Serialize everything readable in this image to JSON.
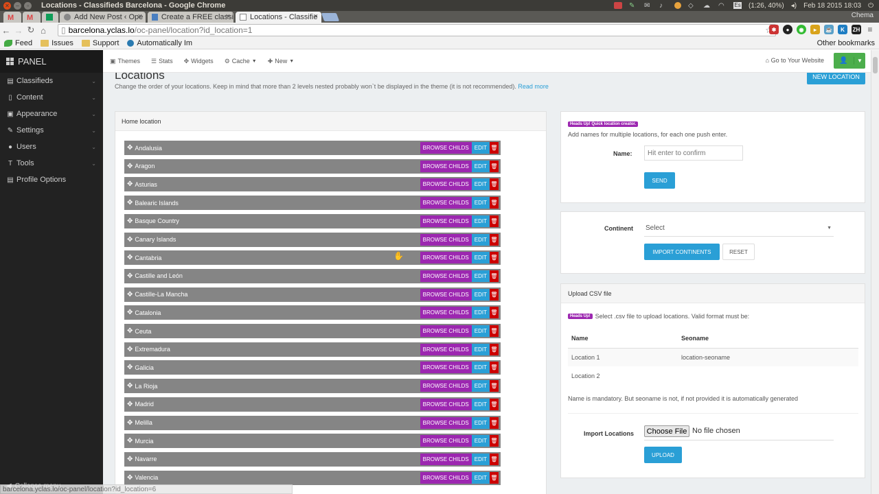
{
  "os": {
    "window_title": "Locations - Classifieds Barcelona - Google Chrome",
    "battery": "(1:26, 40%)",
    "datetime": "Feb 18 2015 18:03",
    "user": "Chema"
  },
  "tabs": [
    {
      "label": ""
    },
    {
      "label": ""
    },
    {
      "label": ""
    },
    {
      "label": "Add New Post ‹ Ope"
    },
    {
      "label": "Create a FREE classi"
    },
    {
      "label": "Locations - Classifie"
    }
  ],
  "address": {
    "host": "barcelona.yclas.lo",
    "path": "/oc-panel/location?id_location=1"
  },
  "bookmarks": {
    "items": [
      "Feed",
      "Issues",
      "Support",
      "Automatically Im"
    ],
    "other": "Other bookmarks"
  },
  "extensions": [
    "ZH"
  ],
  "sidebar": {
    "brand": "PANEL",
    "items": [
      {
        "label": "Classifieds"
      },
      {
        "label": "Content"
      },
      {
        "label": "Appearance"
      },
      {
        "label": "Settings"
      },
      {
        "label": "Users"
      },
      {
        "label": "Tools"
      },
      {
        "label": "Profile Options"
      }
    ],
    "collapse": "Collapse menu"
  },
  "status_url": "barcelona.yclas.lo/oc-panel/location?id_location=6",
  "topnav": {
    "items": [
      "Themes",
      "Stats",
      "Widgets",
      "Cache",
      "New"
    ],
    "goto": "Go to Your Website"
  },
  "page": {
    "title": "Locations",
    "description": "Change the order of your locations. Keep in mind that more than 2 levels nested probably won`t be displayed in the theme (it is not recommended).",
    "read_more": "Read more",
    "new_location": "NEW LOCATION"
  },
  "locations_panel": {
    "title": "Home location",
    "browse_label": "BROWSE CHILDS",
    "edit_label": "EDIT",
    "rows": [
      "Andalusia",
      "Aragon",
      "Asturias",
      "Balearic Islands",
      "Basque Country",
      "Canary Islands",
      "Cantabria",
      "Castille and León",
      "Castille-La Mancha",
      "Catalonia",
      "Ceuta",
      "Extremadura",
      "Galicia",
      "La Rioja",
      "Madrid",
      "Melilla",
      "Murcia",
      "Navarre",
      "Valencia"
    ]
  },
  "quick_creator": {
    "badge": "Heads Up! Quick location creator.",
    "hint": "Add names for multiple locations, for each one push enter.",
    "name_label": "Name:",
    "name_placeholder": "Hit enter to confirm",
    "send": "SEND"
  },
  "continent": {
    "label": "Continent",
    "selected": "Select",
    "import": "IMPORT CONTINENTS",
    "reset": "RESET"
  },
  "csv": {
    "title": "Upload CSV file",
    "badge": "Heads Up!",
    "info": "Select .csv file to upload locations. Valid format must be:",
    "columns": [
      "Name",
      "Seoname"
    ],
    "rows": [
      [
        "Location 1",
        "location-seoname"
      ],
      [
        "Location 2",
        ""
      ]
    ],
    "mandatory": "Name is mandatory. But seoname is not, if not provided it is automatically generated",
    "import_label": "Import Locations",
    "choose_file": "Choose File",
    "no_file": "No file chosen",
    "upload": "UPLOAD"
  }
}
